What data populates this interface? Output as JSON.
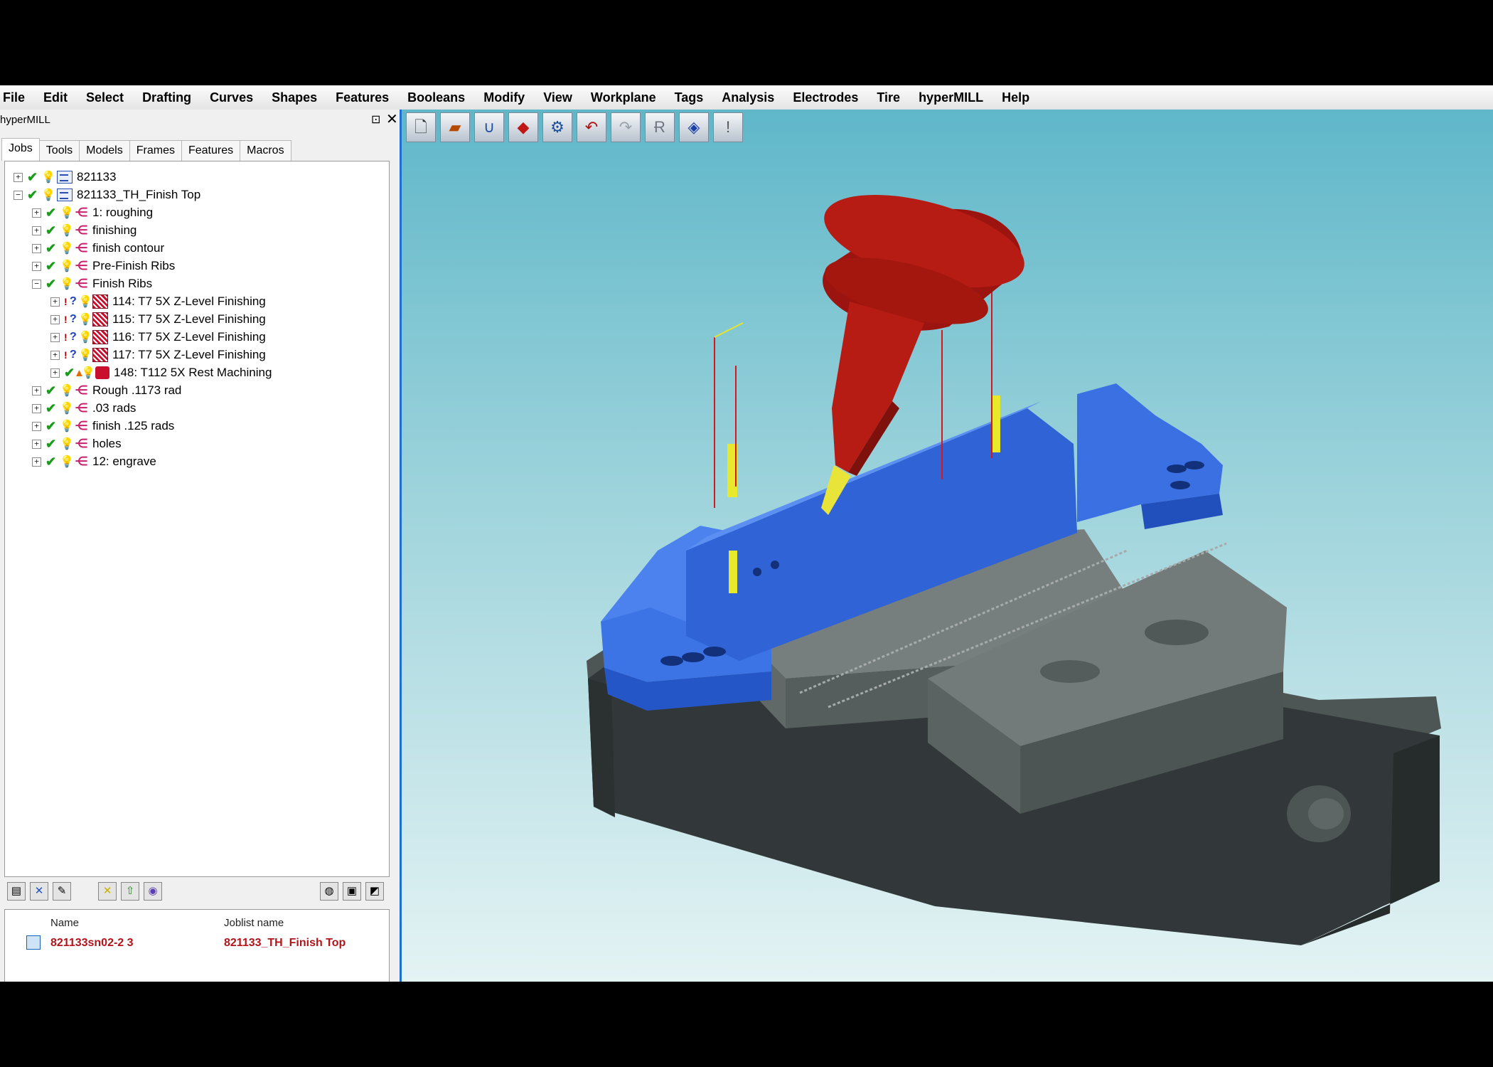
{
  "menu": [
    "File",
    "Edit",
    "Select",
    "Drafting",
    "Curves",
    "Shapes",
    "Features",
    "Booleans",
    "Modify",
    "View",
    "Workplane",
    "Tags",
    "Analysis",
    "Electrodes",
    "Tire",
    "hyperMILL",
    "Help"
  ],
  "panel": {
    "title": "hyperMILL",
    "pin_icon": "pin-icon",
    "close_glyph": "✕",
    "tabs": [
      "Jobs",
      "Tools",
      "Models",
      "Frames",
      "Features",
      "Macros"
    ],
    "active_tab": "Jobs"
  },
  "tree": {
    "nodes": [
      {
        "label": "821133"
      },
      {
        "label": "821133_TH_Finish Top"
      },
      {
        "label": "1: roughing"
      },
      {
        "label": "finishing"
      },
      {
        "label": "finish contour"
      },
      {
        "label": "Pre-Finish Ribs"
      },
      {
        "label": "Finish Ribs"
      },
      {
        "label": "114: T7 5X Z-Level Finishing"
      },
      {
        "label": "115: T7 5X Z-Level Finishing"
      },
      {
        "label": "116: T7 5X Z-Level Finishing"
      },
      {
        "label": "117: T7 5X Z-Level Finishing"
      },
      {
        "label": "148: T112 5X Rest Machining"
      },
      {
        "label": "Rough .1173 rad"
      },
      {
        "label": ".03 rads"
      },
      {
        "label": "finish .125 rads"
      },
      {
        "label": "holes"
      },
      {
        "label": "12: engrave"
      }
    ]
  },
  "joblist": {
    "col_name": "Name",
    "col_joblist": "Joblist name",
    "name": "821133sn02-2 3",
    "joblist_name": "821133_TH_Finish Top"
  },
  "colors": {
    "accent": "#1d6fd1",
    "tool_red": "#b71c14",
    "part_blue": "#2f63d6",
    "vise_dark": "#33393a",
    "vise_grey": "#6f7575",
    "error_text": "#b0151b"
  }
}
